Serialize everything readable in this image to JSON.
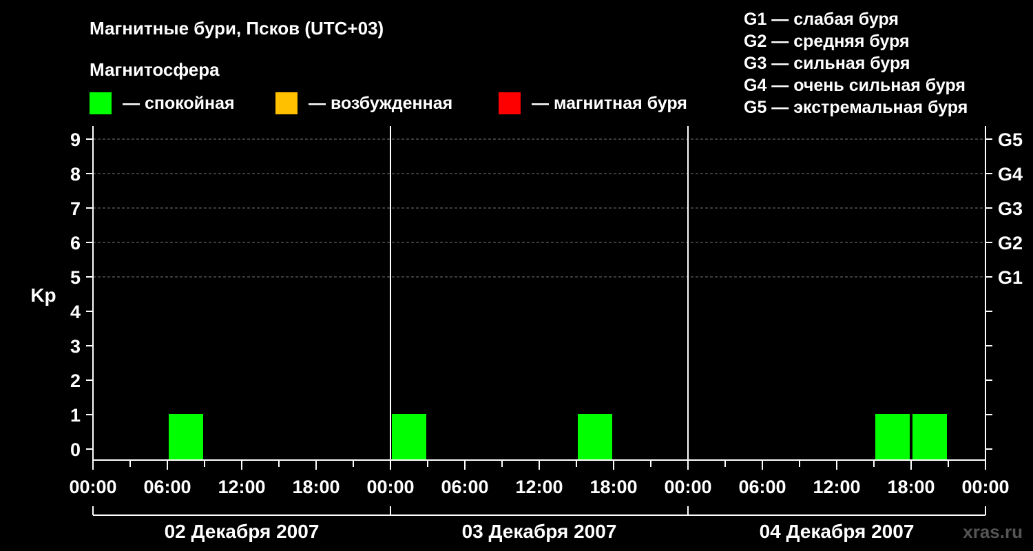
{
  "chart_data": {
    "type": "bar",
    "title": "Магнитные бури, Псков (UTC+03)",
    "legend_title": "Магнитосфера",
    "legend": [
      {
        "label": "— спокойная",
        "color": "#00ff00"
      },
      {
        "label": "— возбужденная",
        "color": "#ffc000"
      },
      {
        "label": "— магнитная буря",
        "color": "#ff0000"
      }
    ],
    "g_scale": [
      "G1 — слабая буря",
      "G2 — средняя буря",
      "G3 — сильная буря",
      "G4 — очень сильная буря",
      "G5 — экстремальная буря"
    ],
    "ylabel": "Kp",
    "ylim": [
      0,
      9
    ],
    "yticks": [
      "0",
      "1",
      "2",
      "3",
      "4",
      "5",
      "6",
      "7",
      "8",
      "9"
    ],
    "right_ticks": [
      {
        "value": 5,
        "label": "G1"
      },
      {
        "value": 6,
        "label": "G2"
      },
      {
        "value": 7,
        "label": "G3"
      },
      {
        "value": 8,
        "label": "G4"
      },
      {
        "value": 9,
        "label": "G5"
      }
    ],
    "xlim_hours": [
      0,
      72
    ],
    "xtick_labels": [
      "00:00",
      "06:00",
      "12:00",
      "18:00",
      "00:00",
      "06:00",
      "12:00",
      "18:00",
      "00:00",
      "06:00",
      "12:00",
      "18:00",
      "00:00"
    ],
    "days": [
      "02 Декабря 2007",
      "03 Декабря 2007",
      "04 Декабря 2007"
    ],
    "bar_width_hours": 3,
    "values": [
      {
        "time": "02 Декабря 2007 06:00",
        "kp": 1,
        "color": "#00ff00"
      },
      {
        "time": "03 Декабря 2007 00:00",
        "kp": 1,
        "color": "#00ff00"
      },
      {
        "time": "03 Декабря 2007 15:00",
        "kp": 1,
        "color": "#00ff00"
      },
      {
        "time": "04 Декабря 2007 15:00",
        "kp": 1,
        "color": "#00ff00"
      },
      {
        "time": "04 Декабря 2007 18:00",
        "kp": 1,
        "color": "#00ff00"
      }
    ],
    "watermark": "xras.ru",
    "grid": true
  }
}
